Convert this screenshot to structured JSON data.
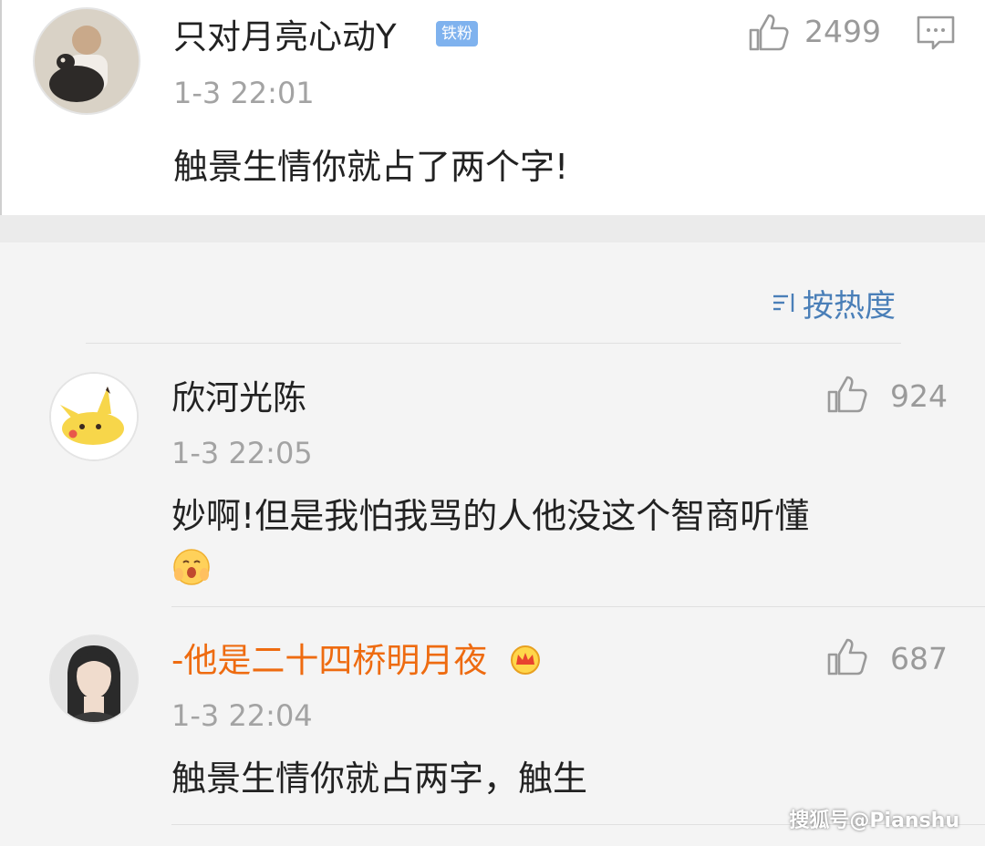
{
  "top_comment": {
    "username": "只对月亮心动Y",
    "badge": "铁粉",
    "time": "1-3 22:01",
    "content": "触景生情你就占了两个字!",
    "likes": "2499",
    "like_icon": "thumbs-up-icon",
    "comment_icon": "comment-icon"
  },
  "sort": {
    "label": "按热度",
    "icon": "sort-icon"
  },
  "replies": [
    {
      "username": "欣河光陈",
      "time": "1-3 22:05",
      "content_line1": "妙啊!但是我怕我骂的人他没这个智商听懂",
      "emoji": "shy-face-emoji",
      "likes": "924"
    },
    {
      "username": "-他是二十四桥明月夜",
      "username_color": "#ee6b10",
      "badge_icon": "crown-icon",
      "time": "1-3 22:04",
      "content": "触景生情你就占两字，触生",
      "likes": "687"
    }
  ],
  "watermark": "搜狐号@Pianshu",
  "colors": {
    "link": "#4a7fb8",
    "vip_name": "#ee6b10",
    "badge": "#7fb2ee",
    "muted": "#a3a3a3"
  }
}
